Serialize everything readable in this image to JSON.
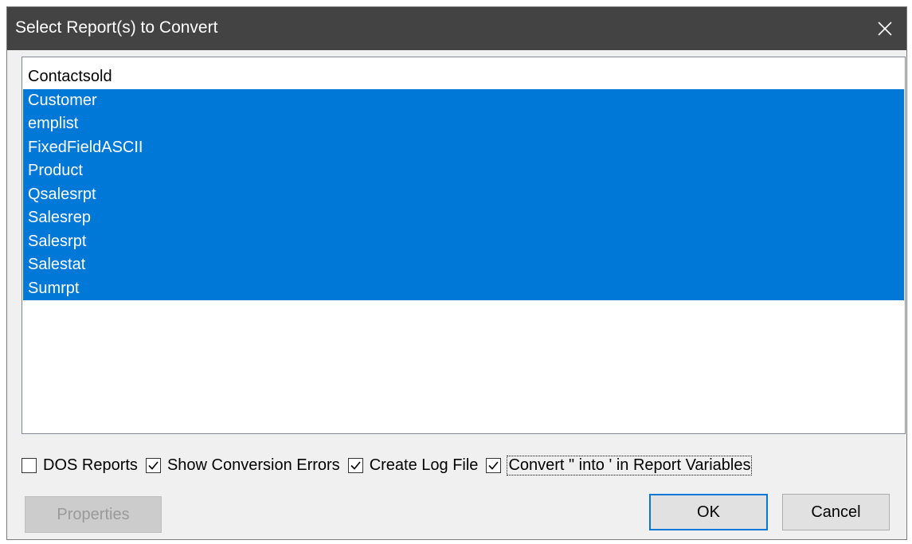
{
  "dialog": {
    "title": "Select Report(s) to Convert",
    "close_icon": "close-icon"
  },
  "reports": [
    {
      "name": "Contactsold",
      "selected": false
    },
    {
      "name": "Customer",
      "selected": true
    },
    {
      "name": "emplist",
      "selected": true
    },
    {
      "name": "FixedFieldASCII",
      "selected": true
    },
    {
      "name": "Product",
      "selected": true
    },
    {
      "name": "Qsalesrpt",
      "selected": true
    },
    {
      "name": "Salesrep",
      "selected": true
    },
    {
      "name": "Salesrpt",
      "selected": true
    },
    {
      "name": "Salestat",
      "selected": true
    },
    {
      "name": "Sumrpt",
      "selected": true
    }
  ],
  "options": {
    "dos_reports": {
      "label": "DOS Reports",
      "checked": false
    },
    "show_conversion_errors": {
      "label": "Show Conversion Errors",
      "checked": true
    },
    "create_log_file": {
      "label": "Create Log File",
      "checked": true
    },
    "convert_quotes": {
      "label": "Convert \" into ' in Report Variables",
      "checked": true
    }
  },
  "buttons": {
    "properties": "Properties",
    "ok": "OK",
    "cancel": "Cancel"
  },
  "colors": {
    "titlebar": "#434343",
    "selection": "#0078d7",
    "dialog_bg": "#f0f0f0"
  }
}
